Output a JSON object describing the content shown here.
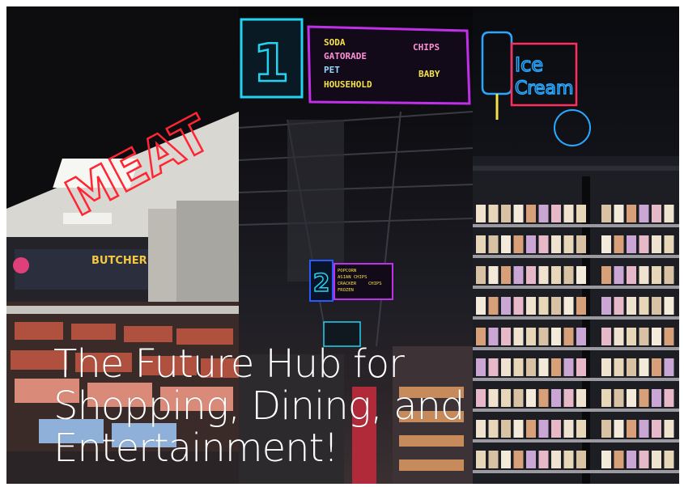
{
  "photo": {
    "panels": [
      {
        "sign_text": "MEAT",
        "sub_sign": "BUTCHER",
        "color": "#e8202a"
      },
      {
        "aisle_number": "1",
        "aisle_items": [
          "SODA",
          "GATORADE",
          "PET",
          "HOUSEHOLD",
          "CHIPS",
          "BABY"
        ],
        "aisle2_number": "2",
        "aisle2_items": [
          "POPCORN",
          "ASIAN CHIPS",
          "CRACKER",
          "CHIPS",
          "FROZEN"
        ],
        "colors": {
          "cyan": "#22d3f2",
          "magenta": "#c030e8",
          "yellow": "#f4e24a"
        }
      },
      {
        "sign_line1": "Ice",
        "sign_line2": "Cream",
        "color": "#2aa8ff",
        "accent": "#ff2e5a"
      }
    ]
  },
  "headline": "The Future Hub for\nShopping, Dining, and\nEntertainment!"
}
